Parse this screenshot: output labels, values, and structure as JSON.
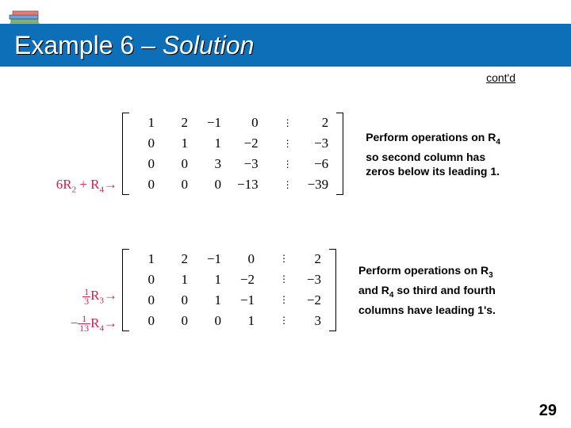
{
  "title_prefix": "Example 6 – ",
  "title_suffix": "Solution",
  "contd": "cont'd",
  "page_number": "29",
  "block1": {
    "op_line4_a": "6R",
    "op_line4_sub": "2",
    "op_line4_b": " + R",
    "op_line4_sub2": "4",
    "arrow": "→",
    "matrix": [
      [
        "1",
        "2",
        "−1",
        "0",
        "⋮",
        "2"
      ],
      [
        "0",
        "1",
        "1",
        "−2",
        "⋮",
        "−3"
      ],
      [
        "0",
        "0",
        "3",
        "−3",
        "⋮",
        "−6"
      ],
      [
        "0",
        "0",
        "0",
        "−13",
        "⋮",
        "−39"
      ]
    ],
    "note_a": "Perform operations on R",
    "note_sub": "4",
    "note_b": " so second column has zeros below its leading 1."
  },
  "block2": {
    "op3_frac_n": "1",
    "op3_frac_d": "3",
    "op3_r": "R",
    "op3_sub": "3",
    "op4_prefix": "−",
    "op4_frac_n": "1",
    "op4_frac_d": "13",
    "op4_r": "R",
    "op4_sub": "4",
    "arrow": "→",
    "matrix": [
      [
        "1",
        "2",
        "−1",
        "0",
        "⋮",
        "2"
      ],
      [
        "0",
        "1",
        "1",
        "−2",
        "⋮",
        "−3"
      ],
      [
        "0",
        "0",
        "1",
        "−1",
        "⋮",
        "−2"
      ],
      [
        "0",
        "0",
        "0",
        "1",
        "⋮",
        "3"
      ]
    ],
    "note_a": "Perform operations on R",
    "note_sub1": "3",
    "note_mid": " and R",
    "note_sub2": "4",
    "note_b": " so third and fourth columns have leading 1's."
  }
}
